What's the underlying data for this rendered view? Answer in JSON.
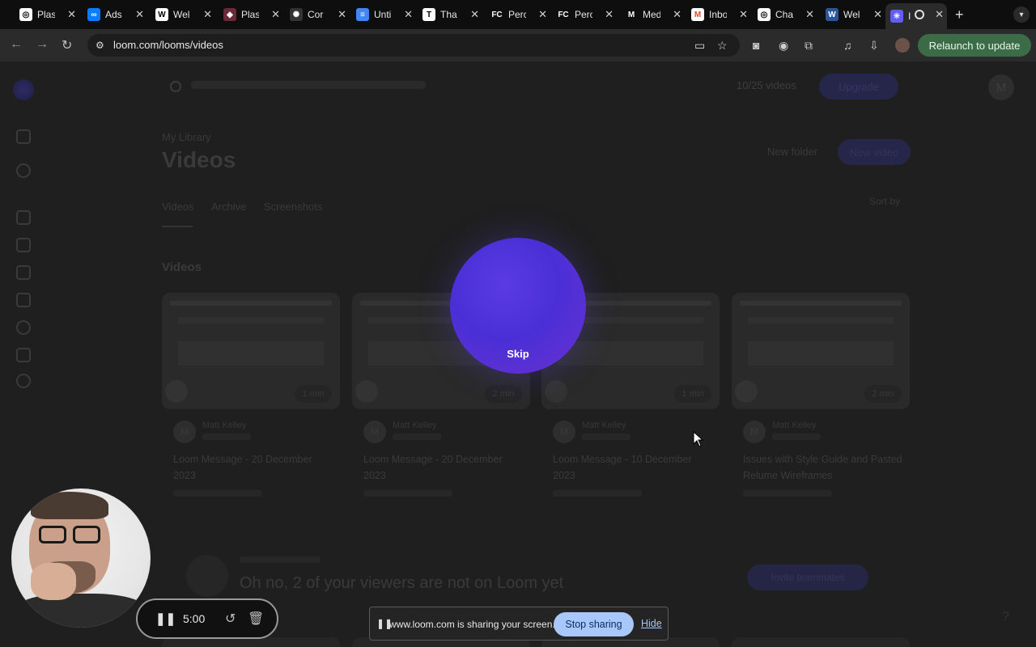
{
  "browser": {
    "tabs": [
      {
        "title": "Plas",
        "icon": "chatgpt-icon",
        "color": "#ffffff"
      },
      {
        "title": "Ads",
        "icon": "meta-icon",
        "color": "#0a7cff"
      },
      {
        "title": "Wel",
        "icon": "webflow-icon",
        "color": "#ffffff"
      },
      {
        "title": "Plas",
        "icon": "figma-icon",
        "color": "#a259ff"
      },
      {
        "title": "Cor",
        "icon": "openai-icon",
        "color": "#888888"
      },
      {
        "title": "Unti",
        "icon": "google-docs-icon",
        "color": "#4285f4"
      },
      {
        "title": "Tha",
        "icon": "news-icon",
        "color": "#ffffff"
      },
      {
        "title": "Perc",
        "icon": "fc-icon",
        "color": "#ffffff"
      },
      {
        "title": "Perc",
        "icon": "fc-icon",
        "color": "#ffffff"
      },
      {
        "title": "Med",
        "icon": "medium-icon",
        "color": "#ffffff"
      },
      {
        "title": "Inbo",
        "icon": "gmail-icon",
        "color": "#ea4335"
      },
      {
        "title": "Cha",
        "icon": "chatgpt-icon",
        "color": "#ffffff"
      },
      {
        "title": "Wel",
        "icon": "word-icon",
        "color": "#2b579a"
      },
      {
        "title": "I",
        "icon": "loom-icon",
        "color": "#625df5"
      }
    ],
    "url": "loom.com/looms/videos",
    "relaunch_label": "Relaunch to update"
  },
  "page": {
    "videos_count": "10/25 videos",
    "upgrade_label": "Upgrade",
    "user_initial": "M",
    "breadcrumb": "My Library",
    "title": "Videos",
    "new_folder_label": "New folder",
    "new_video_label": "New video",
    "tabs": [
      "Videos",
      "Archive",
      "Screenshots"
    ],
    "sort_label": "Sort by",
    "section_title": "Videos",
    "cards": [
      {
        "author": "Matt Kelley",
        "title": "Loom Message - 20 December 2023",
        "duration": "1 min",
        "initial": "M"
      },
      {
        "author": "Matt Kelley",
        "title": "Loom Message - 20 December 2023",
        "duration": "2 min",
        "initial": "M"
      },
      {
        "author": "Matt Kelley",
        "title": "Loom Message - 10 December 2023",
        "duration": "1 min",
        "initial": "M"
      },
      {
        "author": "Matt Kelley",
        "title": "Issues with Style Guide and Pasted Relume Wireframes",
        "duration": "2 min",
        "initial": "M"
      }
    ],
    "invite_text": "Oh no, 2 of your viewers are not on Loom yet",
    "invite_button": "Invite teammates"
  },
  "overlay": {
    "skip_label": "Skip"
  },
  "recording": {
    "time": "5:00"
  },
  "share_bar": {
    "message": "www.loom.com is sharing your screen.",
    "stop_label": "Stop sharing",
    "hide_label": "Hide"
  }
}
